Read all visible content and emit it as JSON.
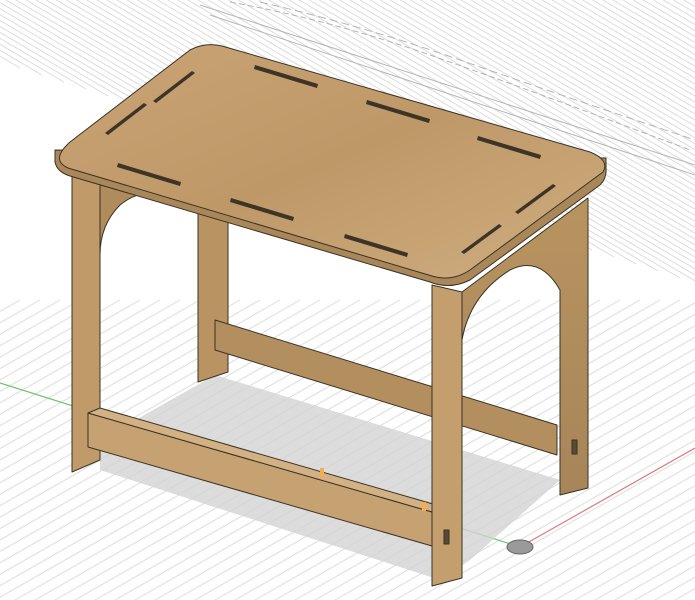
{
  "viewport": {
    "background": "#ffffff",
    "grid_color": "#d8d8d8",
    "x_axis_color": "#e07070",
    "y_axis_color": "#60c060",
    "wood_color": "#c8a577",
    "wood_dark": "#a8865a",
    "edge_color": "#3a3226",
    "shadow_color": "#d4d4d4"
  },
  "model": {
    "object_icon": "table-model",
    "origin_icon": "origin-marker"
  }
}
